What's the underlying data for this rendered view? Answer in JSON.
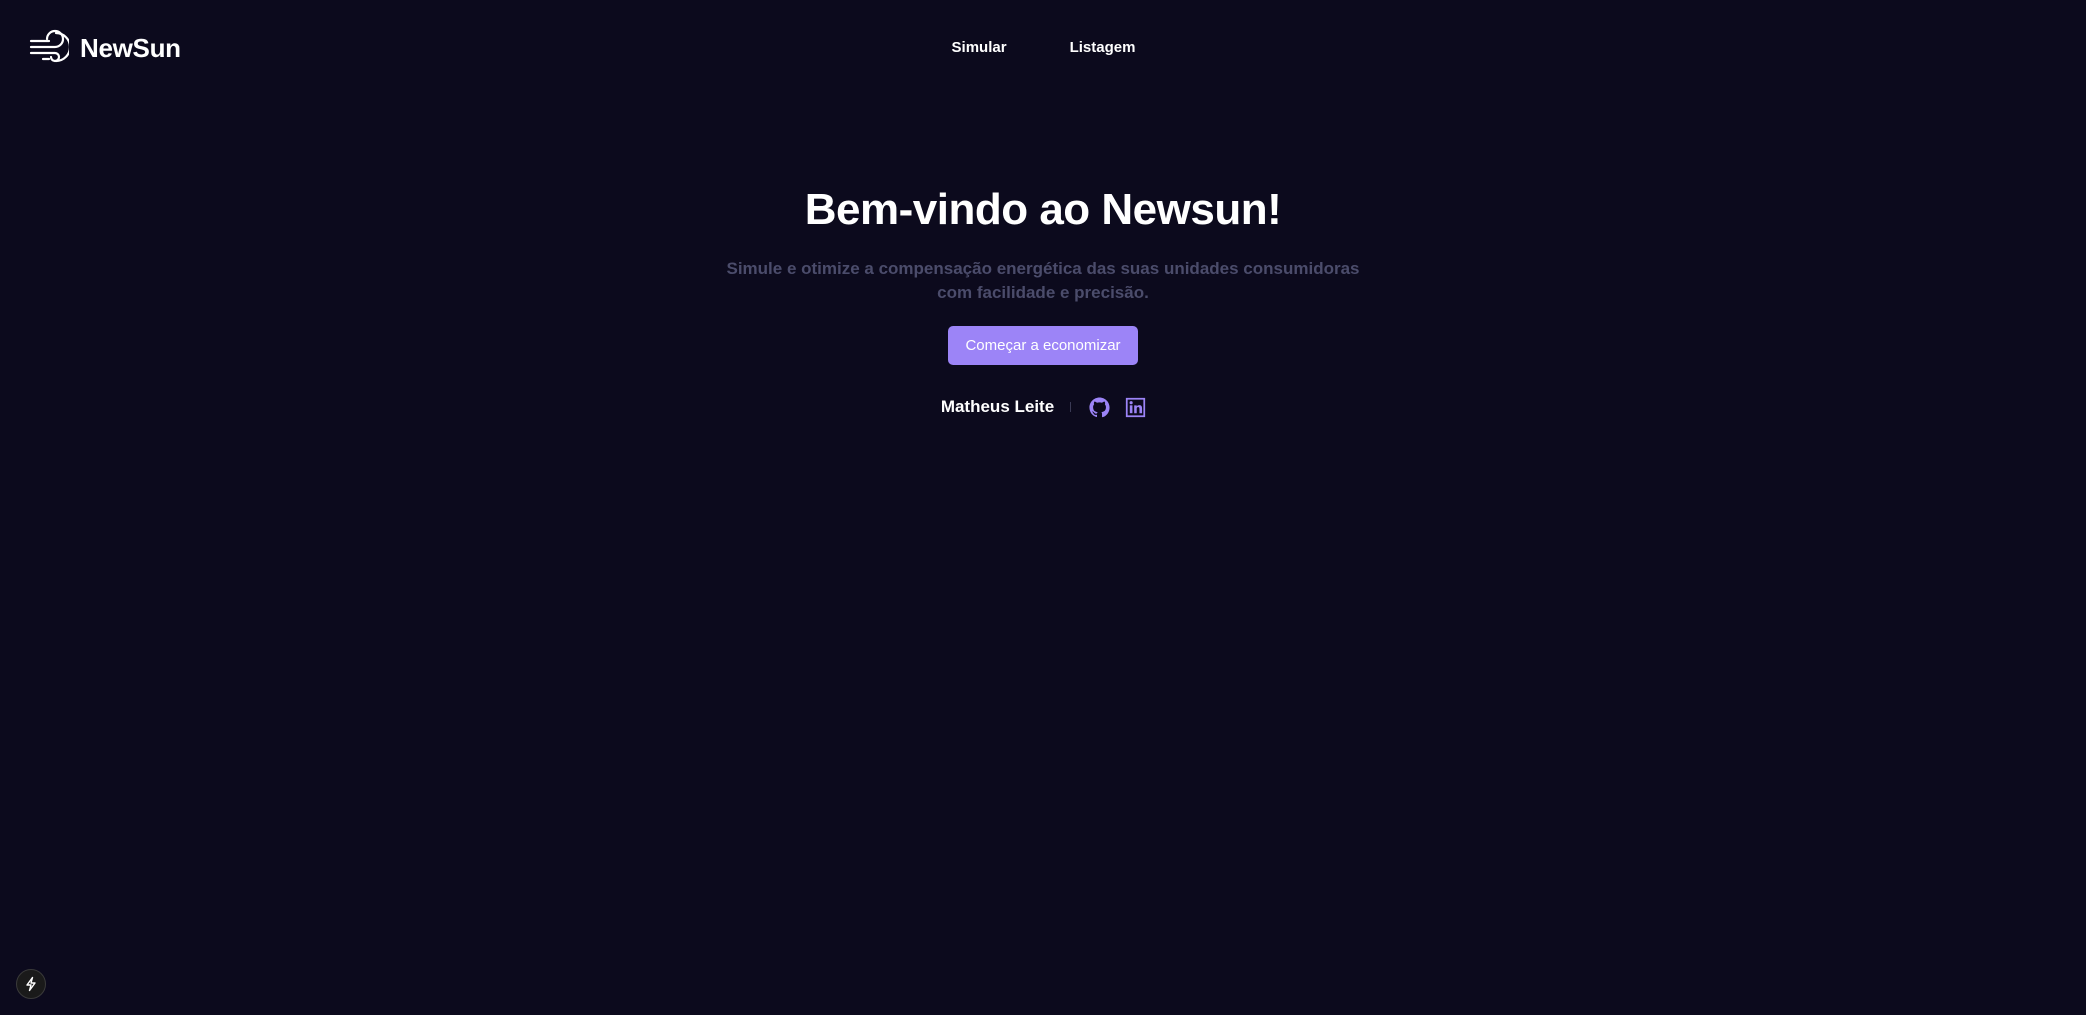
{
  "brand": {
    "name": "NewSun",
    "icon": "wind-icon"
  },
  "nav": {
    "items": [
      {
        "label": "Simular"
      },
      {
        "label": "Listagem"
      }
    ]
  },
  "hero": {
    "title": "Bem-vindo ao Newsun!",
    "subtitle": "Simule e otimize a compensação energética das suas unidades consumidoras com facilidade e precisão.",
    "cta_label": "Começar a economizar"
  },
  "author": {
    "name": "Matheus Leite",
    "links": [
      {
        "icon": "github-icon"
      },
      {
        "icon": "linkedin-icon"
      }
    ]
  },
  "dev_badge": {
    "icon": "lightning-icon"
  },
  "colors": {
    "background": "#0c0a1d",
    "accent": "#9c84f7",
    "muted_text": "#4b4c6b",
    "text": "#ffffff"
  }
}
